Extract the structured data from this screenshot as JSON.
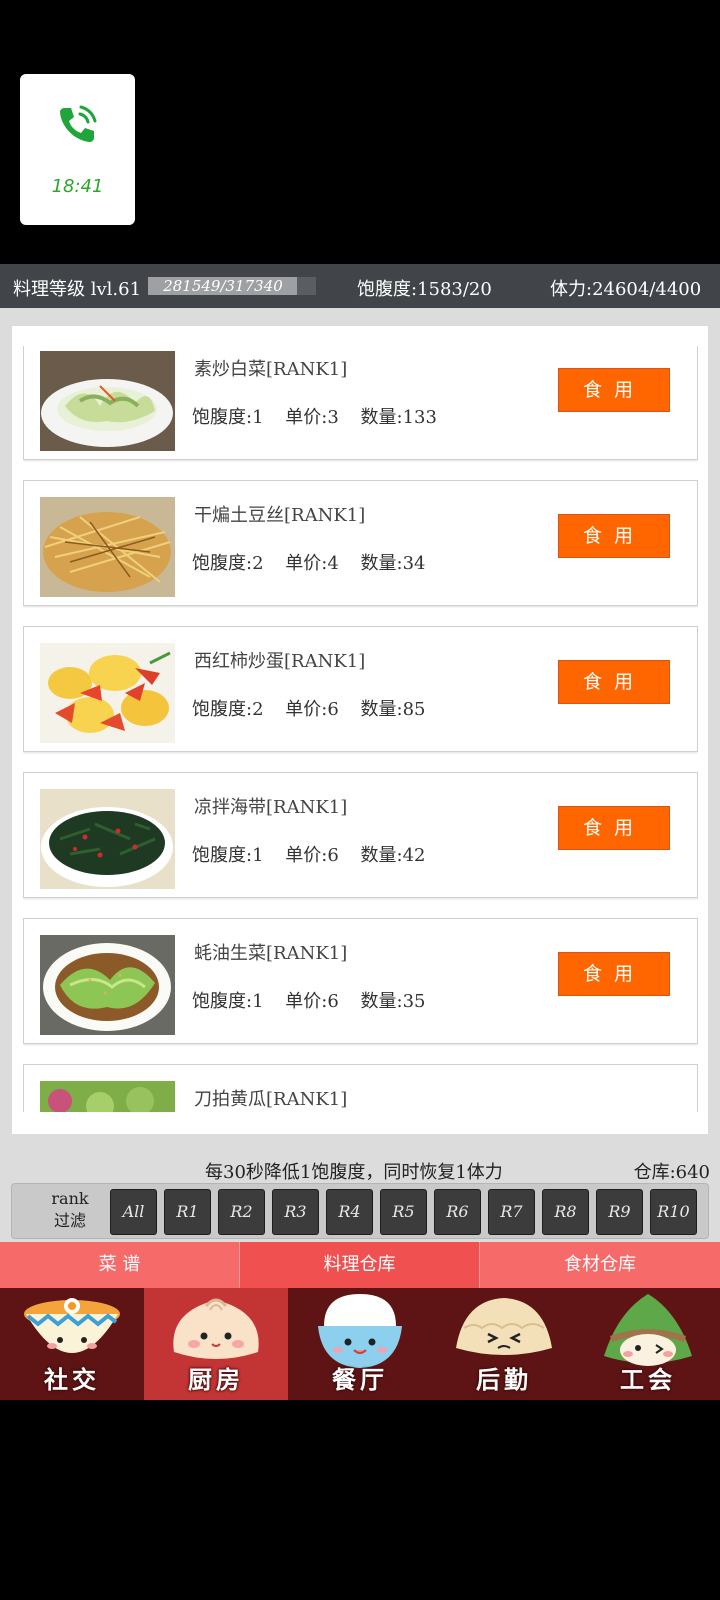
{
  "call": {
    "time": "18:41"
  },
  "status": {
    "level_label": "料理等级 lvl.61",
    "xp_text": "281549/317340",
    "xp_fraction": 0.887,
    "satiety": "饱腹度:1583/20",
    "stamina": "体力:24604/4400"
  },
  "dishes": [
    {
      "name": "素炒白菜[RANK1]",
      "satiety": "饱腹度:1",
      "price": "单价:3",
      "qty": "数量:133",
      "action": "食用"
    },
    {
      "name": "干煸土豆丝[RANK1]",
      "satiety": "饱腹度:2",
      "price": "单价:4",
      "qty": "数量:34",
      "action": "食用"
    },
    {
      "name": "西红柿炒蛋[RANK1]",
      "satiety": "饱腹度:2",
      "price": "单价:6",
      "qty": "数量:85",
      "action": "食用"
    },
    {
      "name": "凉拌海带[RANK1]",
      "satiety": "饱腹度:1",
      "price": "单价:6",
      "qty": "数量:42",
      "action": "食用"
    },
    {
      "name": "蚝油生菜[RANK1]",
      "satiety": "饱腹度:1",
      "price": "单价:6",
      "qty": "数量:35",
      "action": "食用"
    },
    {
      "name": "刀拍黄瓜[RANK1]"
    }
  ],
  "info": {
    "message": "每30秒降低1饱腹度，同时恢复1体力",
    "storage": "仓库:640"
  },
  "filter": {
    "label_line1": "rank",
    "label_line2": "过滤",
    "buttons": [
      "All",
      "R1",
      "R2",
      "R3",
      "R4",
      "R5",
      "R6",
      "R7",
      "R8",
      "R9",
      "R10"
    ]
  },
  "subtabs": [
    "菜 谱",
    "料理仓库",
    "食材仓库"
  ],
  "nav": [
    "社交",
    "厨房",
    "餐厅",
    "后勤",
    "工会"
  ],
  "colors": {
    "accent": "#ff6600",
    "tab_bar": "#f76a6a",
    "nav_bg": "#5e1414",
    "nav_active": "#c33434"
  }
}
